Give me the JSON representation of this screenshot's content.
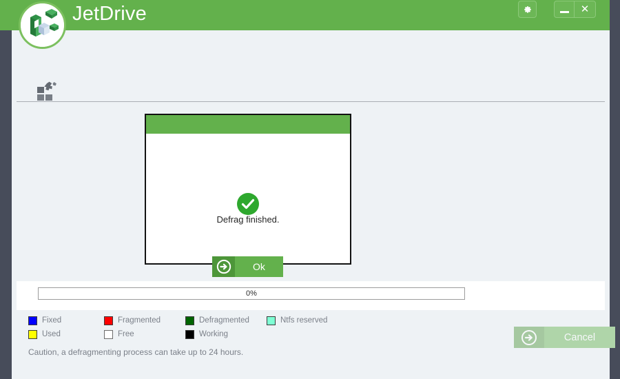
{
  "window": {
    "title": "JetDrive",
    "logo_icon": "jetdrive-logo-icon",
    "controls": {
      "settings_label": "⚙",
      "settings_icon": "gear-icon",
      "minimize_icon": "minimize-icon",
      "close_label": "✕",
      "close_icon": "close-icon"
    }
  },
  "toolbar": {
    "defrag_icon": "defrag-blocks-icon"
  },
  "dialog": {
    "title": "",
    "status_icon": "success-check-icon",
    "message": "Defrag finished.",
    "ok_label": "Ok",
    "ok_icon": "arrow-right-circle-icon"
  },
  "progress": {
    "percent_label": "0%",
    "value": 0
  },
  "legend": {
    "rows": [
      [
        {
          "label": "Fixed",
          "color": "#0000ff"
        },
        {
          "label": "Fragmented",
          "color": "#ff0000"
        },
        {
          "label": "Defragmented",
          "color": "#006400"
        },
        {
          "label": "Ntfs reserved",
          "color": "#7fffd4"
        }
      ],
      [
        {
          "label": "Used",
          "color": "#ffff00"
        },
        {
          "label": "Free",
          "color": "#ffffff"
        },
        {
          "label": "Working",
          "color": "#000000"
        }
      ]
    ]
  },
  "actions": {
    "cancel_label": "Cancel",
    "cancel_icon": "arrow-right-circle-icon",
    "cancel_disabled": true
  },
  "footer": {
    "caution": "Caution, a defragmenting process can take up to 24 hours."
  },
  "colors": {
    "brand_green": "#63b14c",
    "desktop": "#474c5a",
    "panel": "#eef2f5"
  }
}
